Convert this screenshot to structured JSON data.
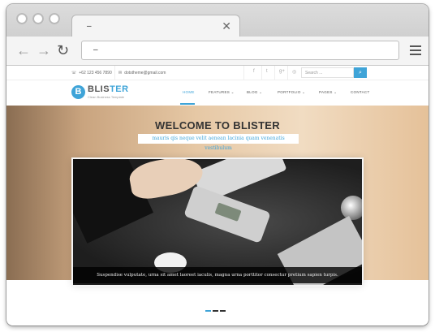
{
  "browser": {
    "tab_title": "–",
    "url": "–",
    "back": "←",
    "forward": "→",
    "reload": "↻",
    "close": "✕"
  },
  "topbar": {
    "phone": "+62 123 456 7890",
    "email": "dotstheme@gmail.com",
    "social": [
      "f",
      "t",
      "g+",
      "◎"
    ],
    "search_placeholder": "Search ...",
    "search_icon": "search-icon"
  },
  "header": {
    "logo_letter": "B",
    "logo_a": "BLIS",
    "logo_b": "TER",
    "tagline": "Clean Business Template",
    "nav": [
      {
        "label": "HOME"
      },
      {
        "label": "FEATURES ⌄"
      },
      {
        "label": "BLOG ⌄"
      },
      {
        "label": "PORTFOLIO ⌄"
      },
      {
        "label": "PAGES ⌄"
      },
      {
        "label": "CONTACT"
      }
    ]
  },
  "hero": {
    "title": "WELCOME TO BLISTER",
    "subtitle": "mauris qis neque velit aenean lacinia quam venenatis vestibulum"
  },
  "slider": {
    "caption": "Suspendise vulputate, urna sit amet laoreet iaculis, magna urna porttitor consectur pretium sapien turpis."
  },
  "colors": {
    "accent": "#3fa4d8"
  }
}
